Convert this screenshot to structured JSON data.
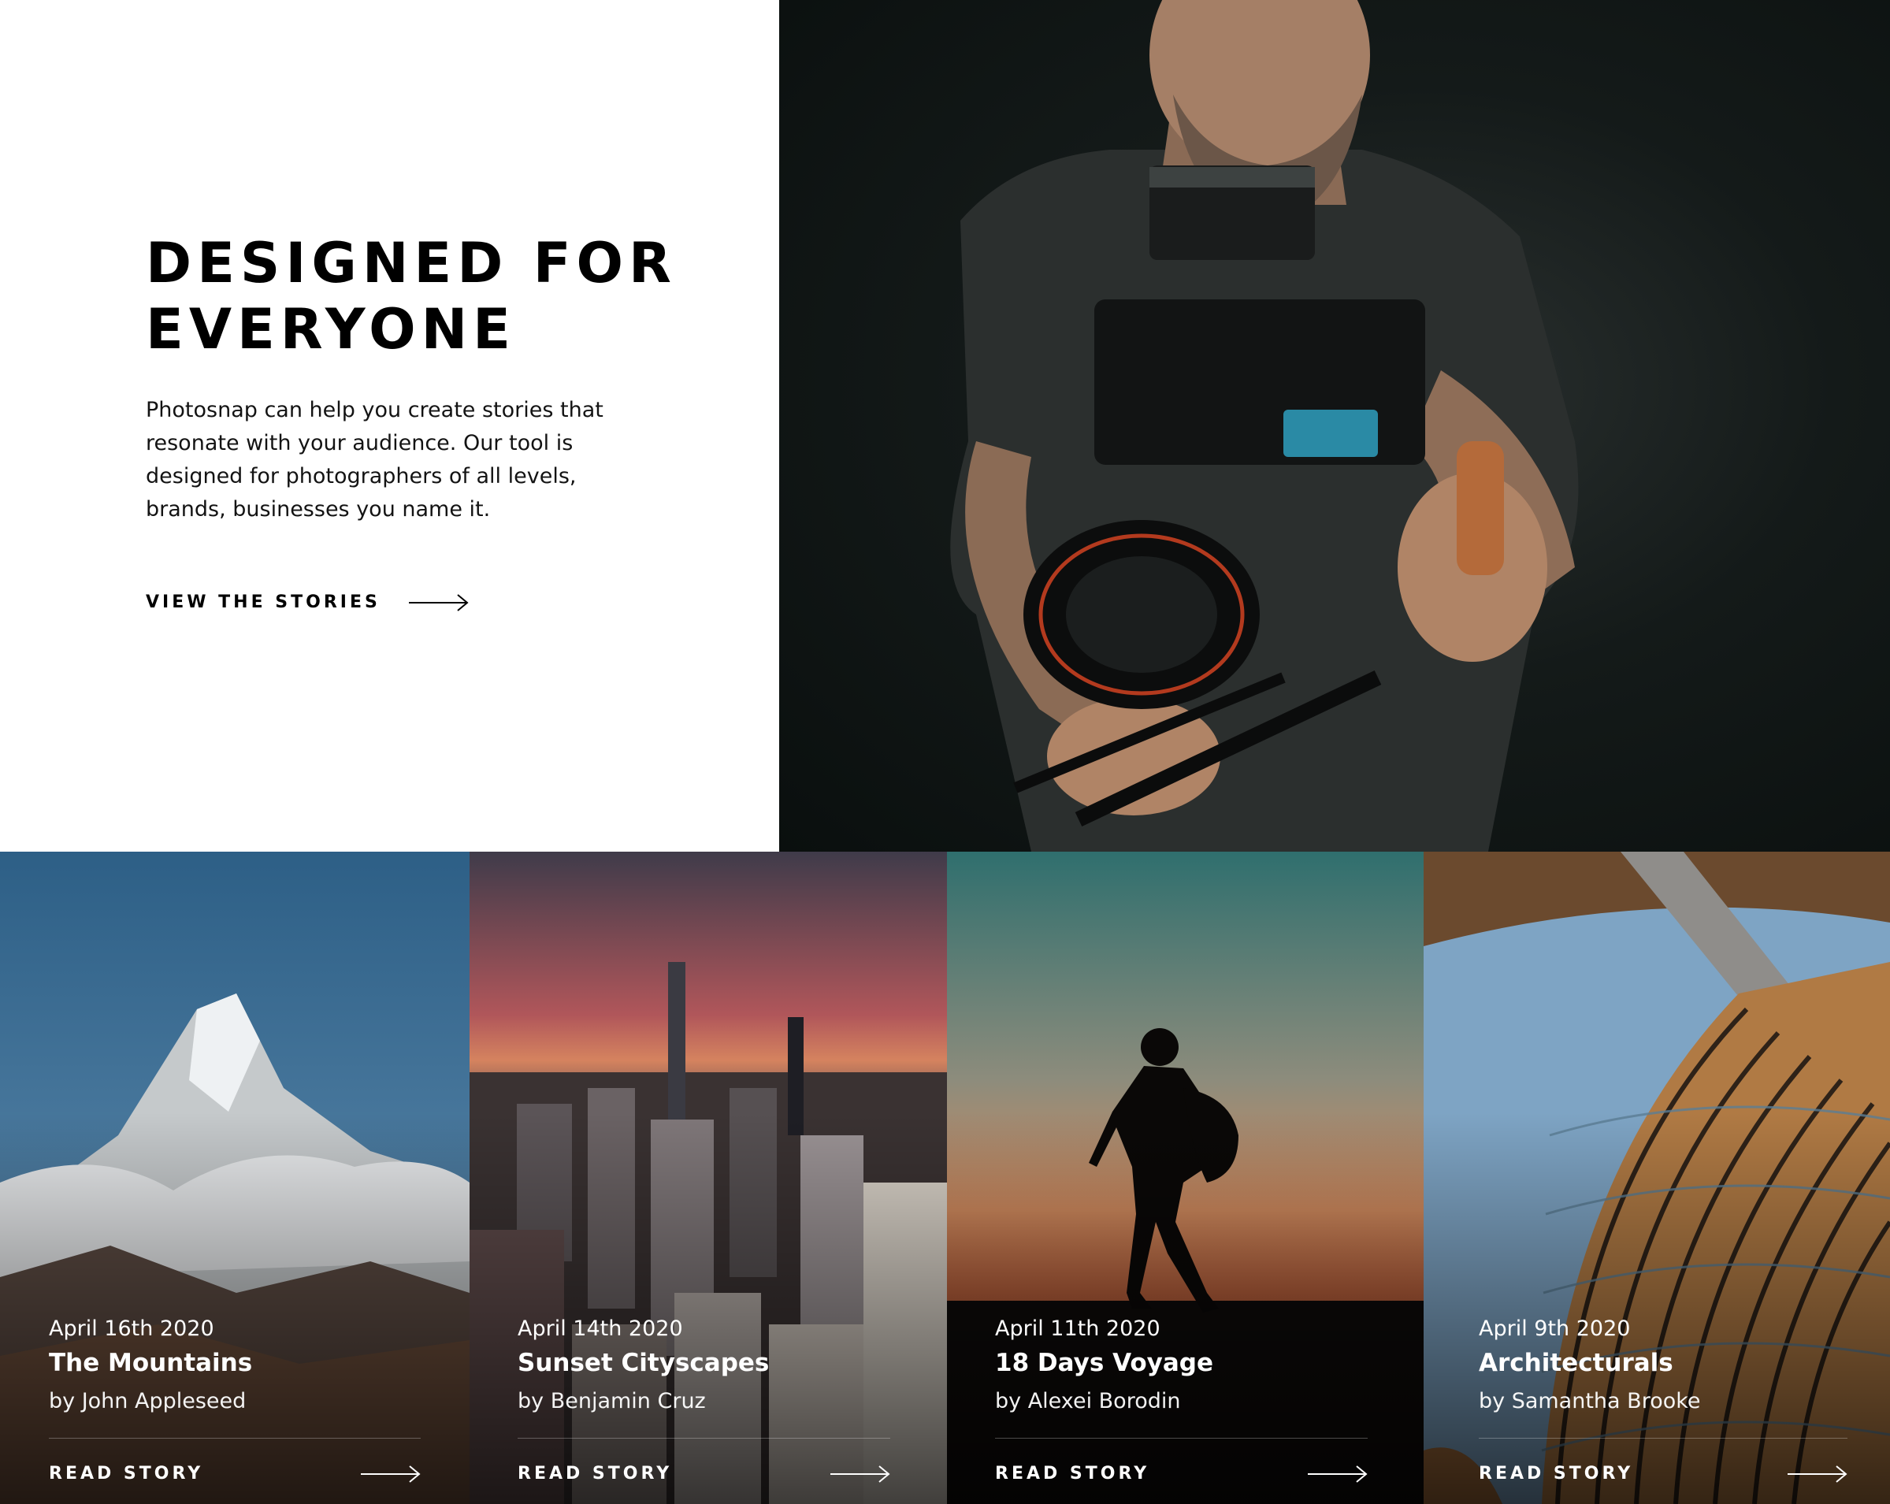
{
  "hero": {
    "title_line1": "DESIGNED FOR",
    "title_line2": "EVERYONE",
    "description": "Photosnap can help you create stories that resonate with your audience. Our tool is designed for photographers of all levels, brands, businesses you name it.",
    "cta_label": "VIEW THE STORIES",
    "cta_icon": "arrow-right-icon",
    "photo": "videographer-photo"
  },
  "stories": [
    {
      "date": "April 16th 2020",
      "title": "The Mountains",
      "author": "by John Appleseed",
      "cta_label": "READ STORY",
      "cta_icon": "arrow-right-icon",
      "photo": "mountain-photo"
    },
    {
      "date": "April 14th 2020",
      "title": "Sunset Cityscapes",
      "author": "by Benjamin Cruz",
      "cta_label": "READ STORY",
      "cta_icon": "arrow-right-icon",
      "photo": "city-photo"
    },
    {
      "date": "April 11th 2020",
      "title": "18 Days Voyage",
      "author": "by Alexei Borodin",
      "cta_label": "READ STORY",
      "cta_icon": "arrow-right-icon",
      "photo": "hiker-silhouette-photo"
    },
    {
      "date": "April 9th 2020",
      "title": "Architecturals",
      "author": "by Samantha Brooke",
      "cta_label": "READ STORY",
      "cta_icon": "arrow-right-icon",
      "photo": "building-photo"
    }
  ],
  "colors": {
    "text_dark": "#000000",
    "background": "#ffffff",
    "text_light": "#ffffff"
  }
}
